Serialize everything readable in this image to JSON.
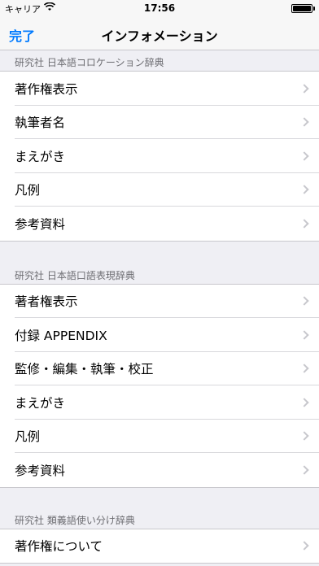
{
  "status_bar": {
    "carrier": "キャリア",
    "time": "17:56",
    "battery_level": 1.0
  },
  "nav": {
    "done_label": "完了",
    "title": "インフォメーション"
  },
  "sections": [
    {
      "header": "研究社 日本語コロケーション辞典",
      "items": [
        "著作権表示",
        "執筆者名",
        "まえがき",
        "凡例",
        "参考資料"
      ]
    },
    {
      "header": "研究社 日本語口語表現辞典",
      "items": [
        "著者権表示",
        "付録 APPENDIX",
        "監修・編集・執筆・校正",
        "まえがき",
        "凡例",
        "参考資料"
      ]
    },
    {
      "header": "研究社 類義語使い分け辞典",
      "items": [
        "著作権について"
      ]
    }
  ],
  "colors": {
    "accent": "#007aff",
    "background": "#efeff4",
    "chevron": "#c7c7cc"
  },
  "icons": [
    "wifi-icon",
    "battery-icon",
    "chevron-right-icon"
  ]
}
